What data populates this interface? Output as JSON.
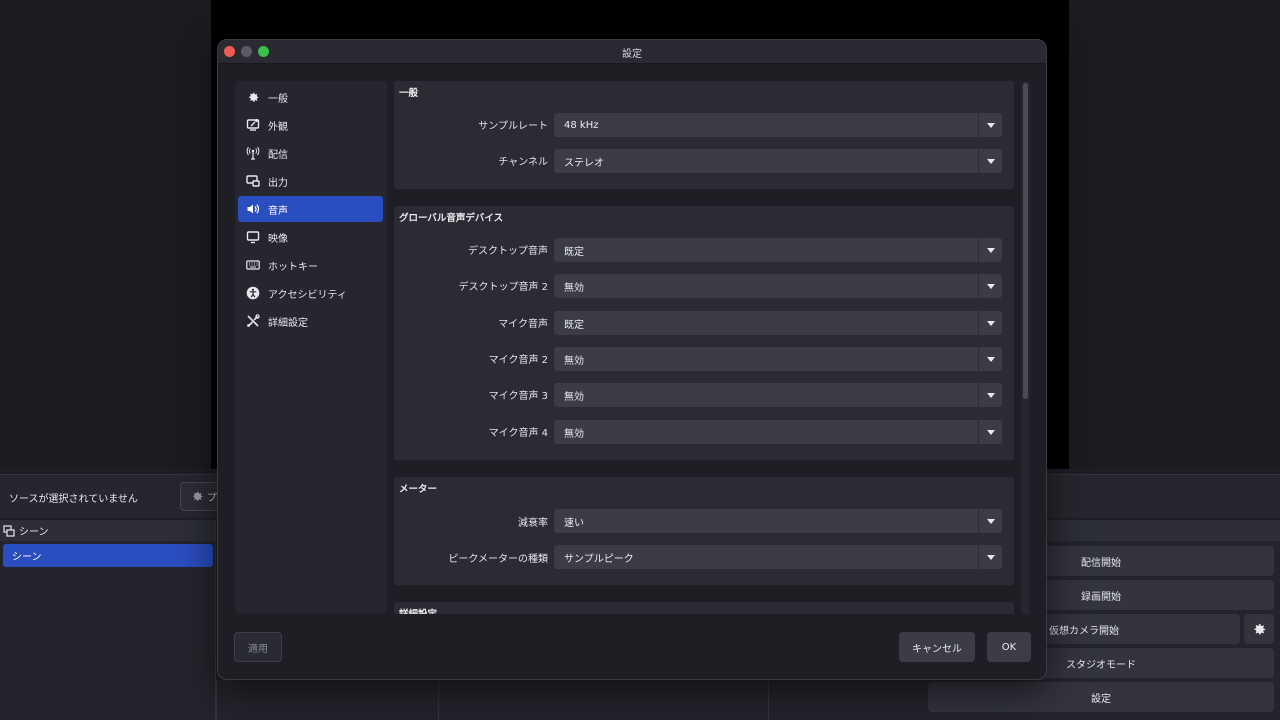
{
  "background": {
    "source_label": "ソースが選択されていません",
    "properties_button": "プ",
    "scenes_header": "シーン",
    "scene_item": "シーン",
    "controls": [
      "配信開始",
      "録画開始",
      "仮想カメラ開始",
      "スタジオモード",
      "設定"
    ]
  },
  "dialog": {
    "title": "設定",
    "nav": [
      {
        "label": "一般",
        "icon": "gear-icon"
      },
      {
        "label": "外観",
        "icon": "appearance-icon"
      },
      {
        "label": "配信",
        "icon": "broadcast-icon"
      },
      {
        "label": "出力",
        "icon": "output-icon"
      },
      {
        "label": "音声",
        "icon": "speaker-icon",
        "active": true
      },
      {
        "label": "映像",
        "icon": "monitor-icon"
      },
      {
        "label": "ホットキー",
        "icon": "keyboard-icon"
      },
      {
        "label": "アクセシビリティ",
        "icon": "accessibility-icon"
      },
      {
        "label": "詳細設定",
        "icon": "tools-icon"
      }
    ],
    "groups": {
      "general": {
        "title": "一般",
        "sample_rate_label": "サンプルレート",
        "sample_rate_value": "48 kHz",
        "channels_label": "チャンネル",
        "channels_value": "ステレオ"
      },
      "devices": {
        "title": "グローバル音声デバイス",
        "rows": [
          {
            "label": "デスクトップ音声",
            "value": "既定"
          },
          {
            "label": "デスクトップ音声 2",
            "value": "無効"
          },
          {
            "label": "マイク音声",
            "value": "既定"
          },
          {
            "label": "マイク音声 2",
            "value": "無効"
          },
          {
            "label": "マイク音声 3",
            "value": "無効"
          },
          {
            "label": "マイク音声 4",
            "value": "無効"
          }
        ]
      },
      "meters": {
        "title": "メーター",
        "decay_label": "減衰率",
        "decay_value": "速い",
        "peak_label": "ピークメーターの種類",
        "peak_value": "サンプルピーク"
      },
      "advanced": {
        "title": "詳細設定"
      }
    },
    "buttons": {
      "apply": "適用",
      "cancel": "キャンセル",
      "ok": "OK"
    }
  }
}
